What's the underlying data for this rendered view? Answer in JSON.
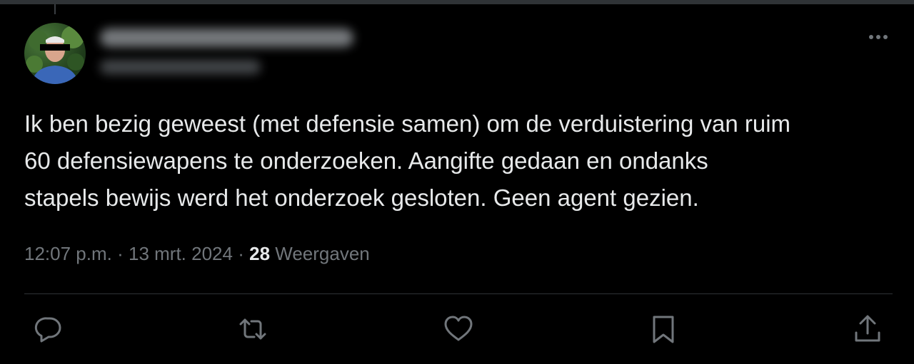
{
  "tweet": {
    "text": "Ik ben bezig geweest (met defensie samen) om de verduistering van ruim\n60 defensiewapens te onderzoeken. Aangifte gedaan en ondanks\nstapels bewijs werd het onderzoek gesloten. Geen agent gezien.",
    "time": "12:07 p.m.",
    "separator": "·",
    "date": "13 mrt. 2024",
    "views_count": "28",
    "views_label": "Weergaven"
  },
  "actions": [
    {
      "icon": "reply-icon"
    },
    {
      "icon": "retweet-icon"
    },
    {
      "icon": "like-icon"
    },
    {
      "icon": "bookmark-icon"
    },
    {
      "icon": "share-icon"
    }
  ],
  "colors": {
    "background": "#000000",
    "text_primary": "#e7e9ea",
    "text_secondary": "#71767b",
    "divider": "#2f3336"
  }
}
